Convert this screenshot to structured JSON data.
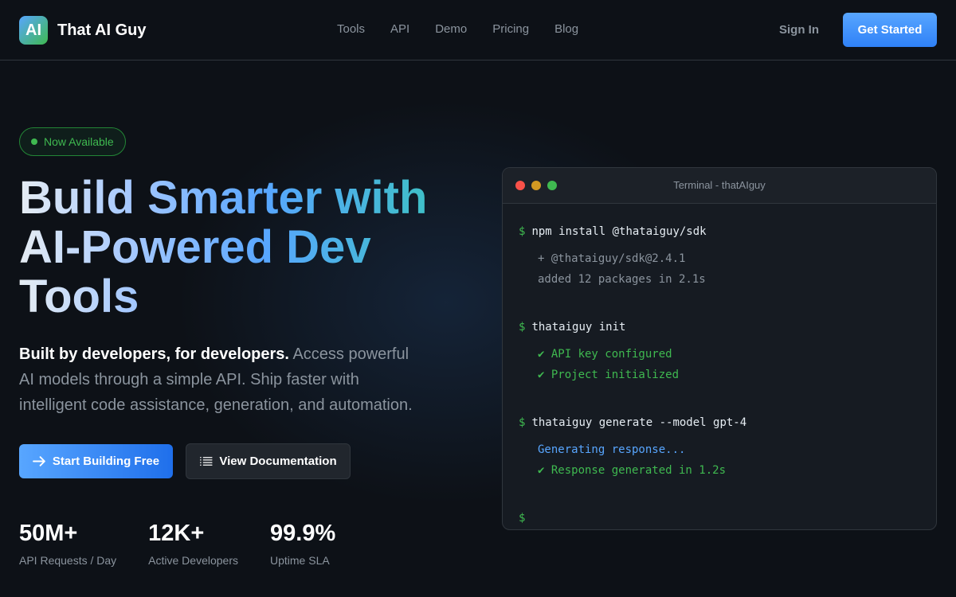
{
  "brand": {
    "logo_text": "AI",
    "name": "That AI Guy"
  },
  "nav": {
    "links": [
      "Tools",
      "API",
      "Demo",
      "Pricing",
      "Blog"
    ],
    "signin": "Sign In",
    "cta": "Get Started"
  },
  "hero": {
    "badge": "Now Available",
    "headline": "Build Smarter with AI-Powered Dev Tools",
    "sub_bold": "Built by developers, for developers.",
    "sub_rest": " Access powerful AI models through a simple API. Ship faster with intelligent code assistance, generation, and automation.",
    "primary_button": "Start Building Free",
    "secondary_button": "View Documentation"
  },
  "stats": [
    {
      "value": "50M+",
      "label": "API Requests / Day"
    },
    {
      "value": "12K+",
      "label": "Active Developers"
    },
    {
      "value": "99.9%",
      "label": "Uptime SLA"
    }
  ],
  "terminal": {
    "title": "Terminal - thatAIguy",
    "prompt": "$",
    "blocks": [
      {
        "cmd": "npm install @thataiguy/sdk",
        "out": [
          {
            "text": "+ @thataiguy/sdk@2.4.1",
            "kind": "muted"
          },
          {
            "text": "added 12 packages in 2.1s",
            "kind": "muted"
          }
        ]
      },
      {
        "cmd": "thataiguy init",
        "out": [
          {
            "text": "✔ API key configured",
            "kind": "ok"
          },
          {
            "text": "✔ Project initialized",
            "kind": "ok"
          }
        ]
      },
      {
        "cmd": "thataiguy generate --model gpt-4",
        "out": [
          {
            "text": "Generating response...",
            "kind": "info"
          },
          {
            "text": "✔ Response generated in 1.2s",
            "kind": "ok"
          }
        ]
      }
    ]
  },
  "colors": {
    "background": "#0d1117",
    "accent_blue": "#58a6ff",
    "accent_green": "#3fb950",
    "muted": "#8b949e"
  },
  "icons": {
    "primary_button": "arrow-right-icon",
    "secondary_button": "list-icon"
  }
}
